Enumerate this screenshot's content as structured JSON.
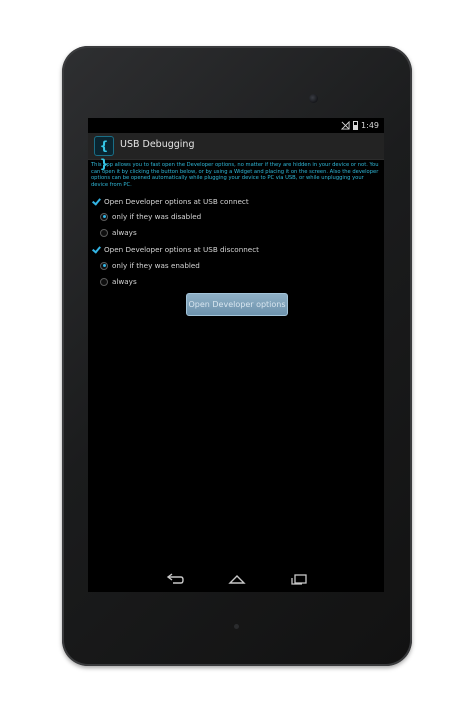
{
  "status_bar": {
    "time": "1:49"
  },
  "action_bar": {
    "title": "USB Debugging",
    "icon": "curly-braces-icon"
  },
  "description": "This app allows you to fast open the Developer options, no matter if they are hidden in your device or not. You can open it by clicking the button below, or by using a Widget and placing it on the screen. Also the developer options can be opened automatically while plugging your device to PC via USB, or while unplugging your device from PC.",
  "options": {
    "connect": {
      "label": "Open Developer options at USB connect",
      "checked": true,
      "choices": [
        {
          "label": "only if they was disabled",
          "selected": true
        },
        {
          "label": "always",
          "selected": false
        }
      ]
    },
    "disconnect": {
      "label": "Open Developer options at USB disconnect",
      "checked": true,
      "choices": [
        {
          "label": "only if they was enabled",
          "selected": true
        },
        {
          "label": "always",
          "selected": false
        }
      ]
    }
  },
  "button": {
    "label": "Open Developer options"
  },
  "nav_bar": {
    "icons": [
      "back-icon",
      "home-icon",
      "recent-apps-icon"
    ]
  },
  "colors": {
    "accent": "#33b5e5",
    "description_text": "#2fb8d8",
    "action_bar": "#232323"
  }
}
